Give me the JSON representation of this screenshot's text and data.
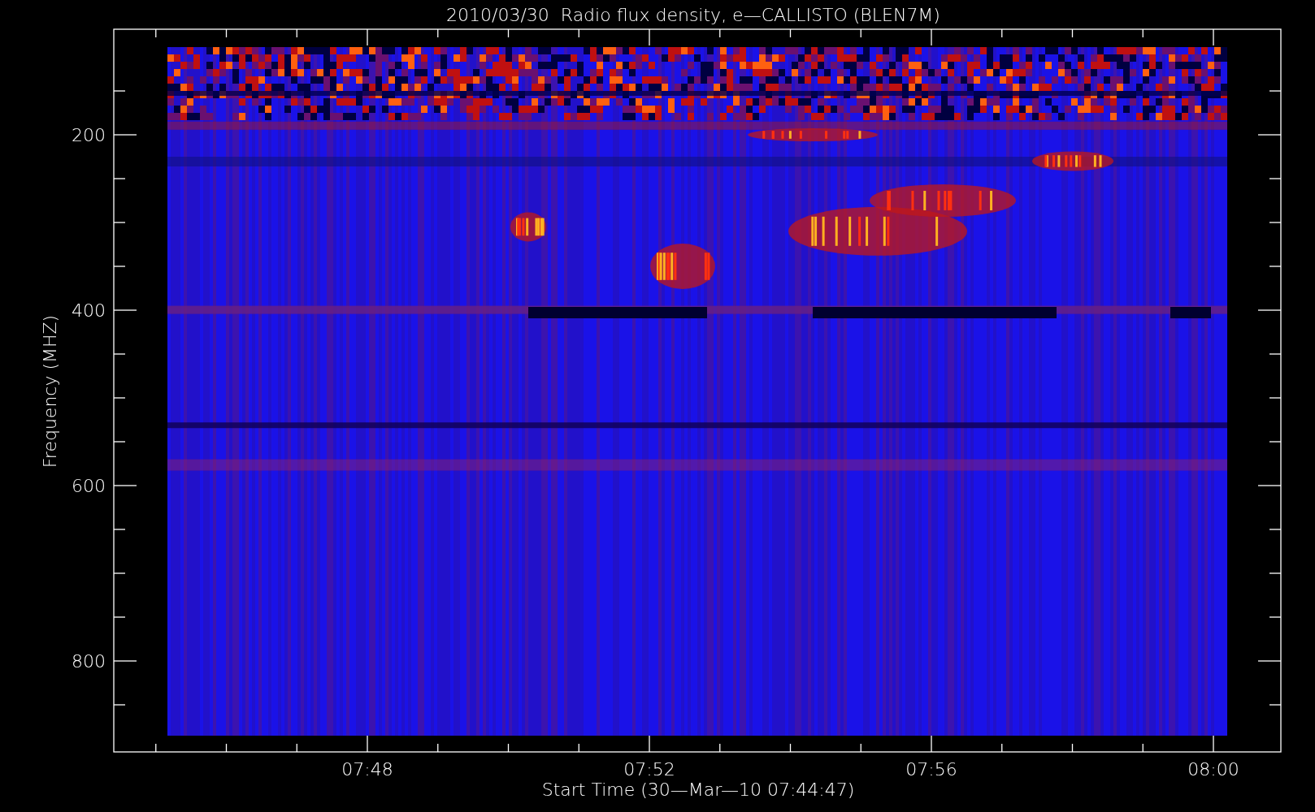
{
  "title": "2010/03/30  Radio flux density, e—CALLISTO (BLEN7M)",
  "y_axis": {
    "label": "Frequency (MHZ)",
    "ticks": [
      "200",
      "400",
      "600",
      "800"
    ]
  },
  "x_axis": {
    "label": "Start Time (30—Mar—10 07:44:47)",
    "ticks": [
      "07:48",
      "07:52",
      "07:56",
      "08:00"
    ]
  }
}
